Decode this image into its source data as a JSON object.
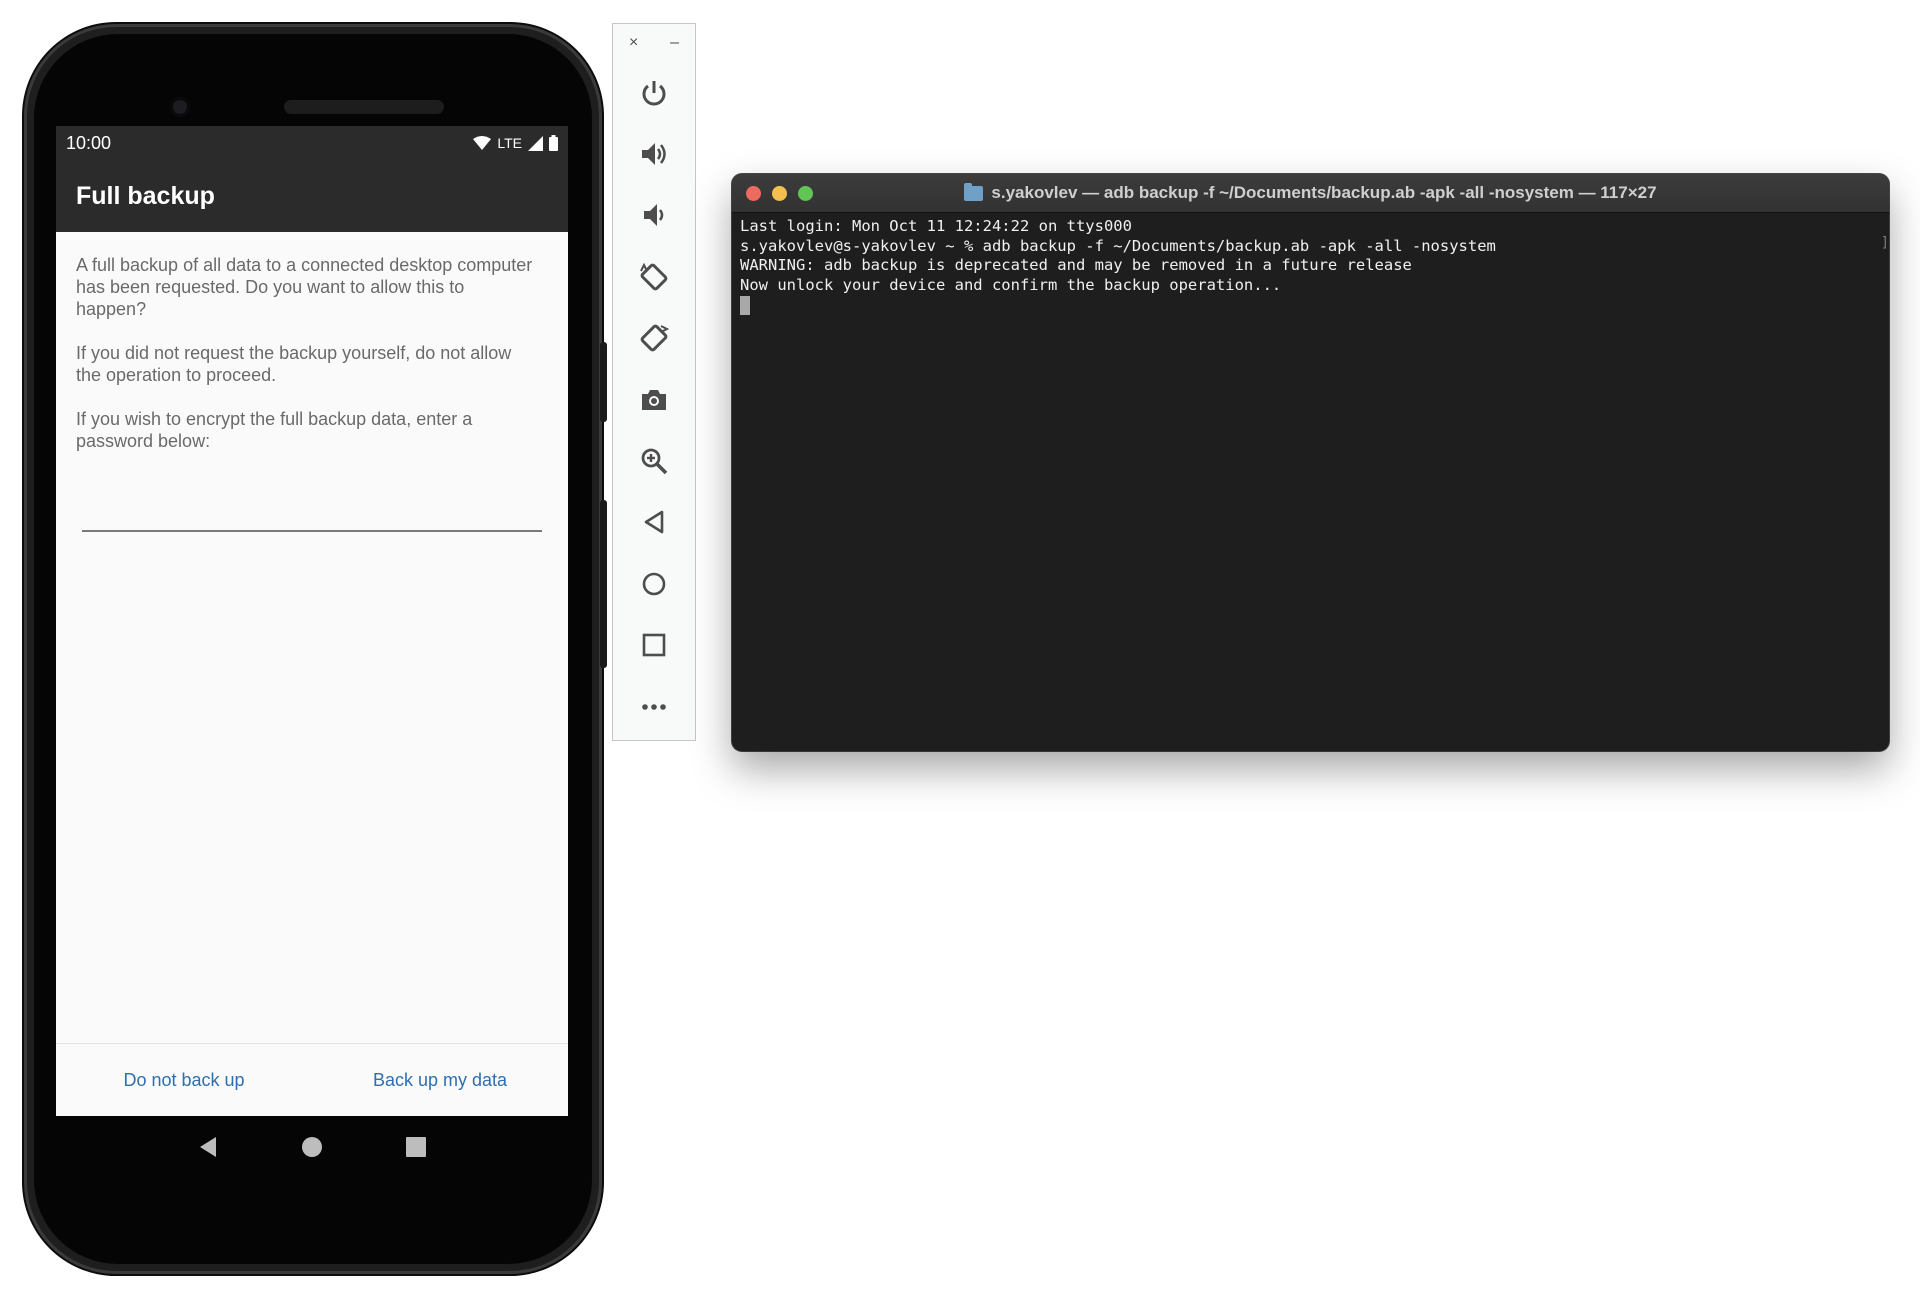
{
  "phone": {
    "status_bar": {
      "time": "10:00",
      "network": "LTE"
    },
    "app_bar": {
      "title": "Full backup"
    },
    "dialog": {
      "paragraph1": "A full backup of all data to a connected desktop computer has been requested. Do you want to allow this to happen?",
      "paragraph2": "If you did not request the backup yourself, do not allow the operation to proceed.",
      "paragraph3": "If you wish to encrypt the full backup data, enter a password below:",
      "password_value": "",
      "deny_label": "Do not back up",
      "allow_label": "Back up my data"
    },
    "nav": {
      "back": "back-icon",
      "home": "home-icon",
      "recents": "recents-icon"
    }
  },
  "emulator_toolbar": {
    "close": "×",
    "minimize": "–",
    "items": [
      "power-icon",
      "volume-up-icon",
      "volume-down-icon",
      "rotate-left-icon",
      "rotate-right-icon",
      "camera-icon",
      "zoom-icon",
      "back-icon",
      "home-icon",
      "overview-icon",
      "more-icon"
    ]
  },
  "terminal": {
    "title": "s.yakovlev — adb backup -f ~/Documents/backup.ab -apk -all -nosystem — 117×27",
    "lines": [
      "Last login: Mon Oct 11 12:24:22 on ttys000",
      "s.yakovlev@s-yakovlev ~ % adb backup -f ~/Documents/backup.ab -apk -all -nosystem",
      "WARNING: adb backup is deprecated and may be removed in a future release",
      "Now unlock your device and confirm the backup operation..."
    ],
    "colors": {
      "close": "#ed6a5e",
      "minimize": "#f5bf4f",
      "maximize": "#61c554",
      "background": "#1e1e1e"
    }
  }
}
